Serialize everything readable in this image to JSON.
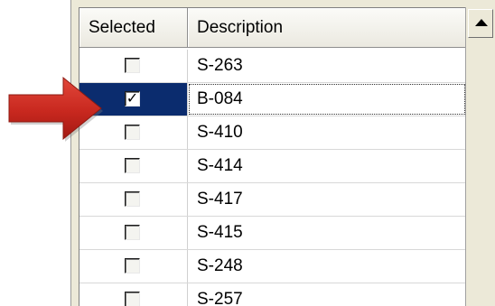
{
  "grid": {
    "columns": {
      "selected": "Selected",
      "description": "Description"
    },
    "rows": [
      {
        "description": "S-263",
        "checked": false,
        "check_mark": ""
      },
      {
        "description": "B-084",
        "checked": true,
        "check_mark": "✓"
      },
      {
        "description": "S-410",
        "checked": false,
        "check_mark": ""
      },
      {
        "description": "S-414",
        "checked": false,
        "check_mark": ""
      },
      {
        "description": "S-417",
        "checked": false,
        "check_mark": ""
      },
      {
        "description": "S-415",
        "checked": false,
        "check_mark": ""
      },
      {
        "description": "S-248",
        "checked": false,
        "check_mark": ""
      },
      {
        "description": "S-257",
        "checked": false,
        "check_mark": ""
      }
    ],
    "active_row_index": 1
  },
  "colors": {
    "selection_background": "#0b2c6e",
    "arrow_fill": "#d4372b"
  },
  "icons": {
    "pointer_arrow": "right-arrow-icon",
    "scroll_up": "scroll-up-arrow-icon"
  }
}
